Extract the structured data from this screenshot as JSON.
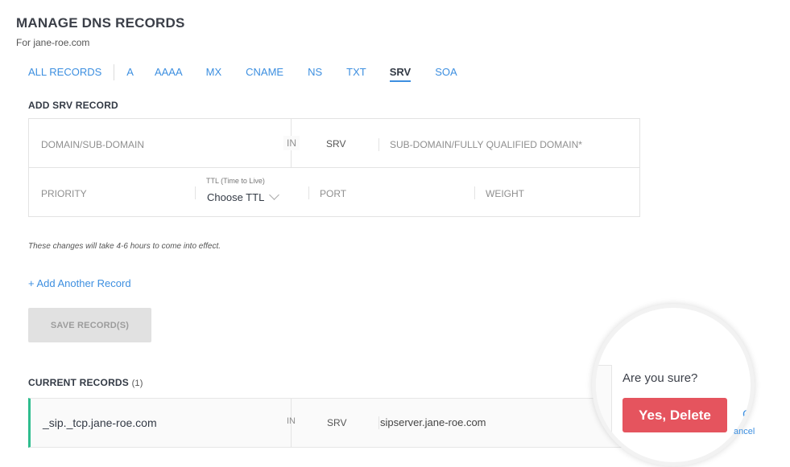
{
  "header": {
    "title": "MANAGE DNS RECORDS",
    "subtitle": "For jane-roe.com"
  },
  "tabs": [
    {
      "label": "ALL RECORDS",
      "active": false
    },
    {
      "label": "A",
      "active": false
    },
    {
      "label": "AAAA",
      "active": false
    },
    {
      "label": "MX",
      "active": false
    },
    {
      "label": "CNAME",
      "active": false
    },
    {
      "label": "NS",
      "active": false
    },
    {
      "label": "TXT",
      "active": false
    },
    {
      "label": "SRV",
      "active": true
    },
    {
      "label": "SOA",
      "active": false
    }
  ],
  "add_form": {
    "heading": "ADD SRV RECORD",
    "domain_placeholder": "DOMAIN/SUB-DOMAIN",
    "class_label": "IN",
    "type_label": "SRV",
    "target_placeholder": "SUB-DOMAIN/FULLY QUALIFIED DOMAIN*",
    "priority_placeholder": "PRIORITY",
    "ttl_label": "TTL (Time to Live)",
    "ttl_value": "Choose TTL",
    "port_placeholder": "PORT",
    "weight_placeholder": "WEIGHT",
    "note": "These changes will take 4-6 hours to come into effect.",
    "add_another_label": "+ Add Another Record",
    "save_label": "SAVE RECORD(S)"
  },
  "current_records": {
    "heading": "CURRENT RECORDS",
    "count": "(1)",
    "records": [
      {
        "name": "_sip._tcp.jane-roe.com",
        "class": "IN",
        "type": "SRV",
        "target": "sipserver.jane-roe.com"
      }
    ]
  },
  "delete_confirm": {
    "question": "Are you sure?",
    "confirm_label": "Yes, Delete",
    "cancel_icon_glyph": "C",
    "cancel_label": "ancel",
    "confirm_color": "#e5545e"
  },
  "colors": {
    "accent": "#3d8fe0",
    "record_marker": "#2fbd8e"
  }
}
